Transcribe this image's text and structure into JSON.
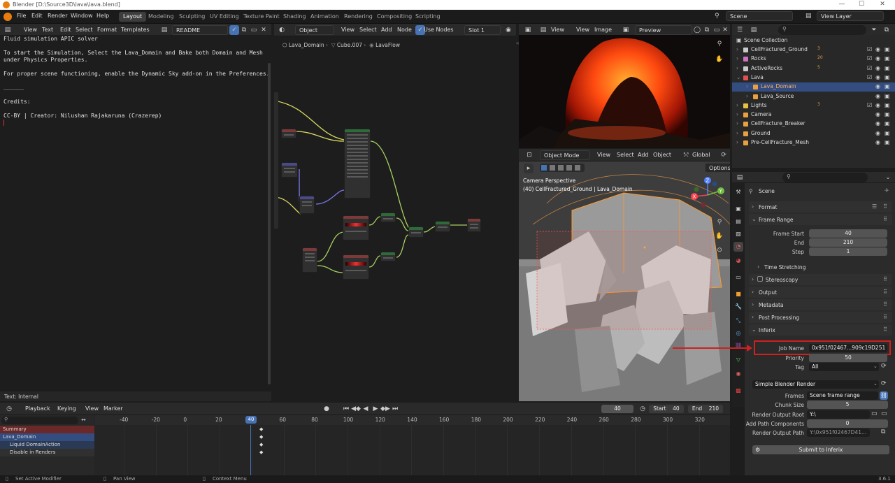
{
  "window": {
    "title": "Blender [D:\\Source3D\\lava\\lava.blend]"
  },
  "menubar": {
    "menus": [
      "File",
      "Edit",
      "Render",
      "Window",
      "Help"
    ],
    "workspaces": [
      "Layout",
      "Modeling",
      "Sculpting",
      "UV Editing",
      "Texture Paint",
      "Shading",
      "Animation",
      "Rendering",
      "Compositing",
      "Scripting"
    ],
    "active_workspace": "Layout",
    "scene": "Scene",
    "view_layer": "View Layer"
  },
  "text_editor": {
    "menus": [
      "View",
      "Text",
      "Edit",
      "Select",
      "Format",
      "Templates"
    ],
    "file": "README",
    "lines": [
      "Fluid simulation APIC solver",
      "",
      "To start the Simulation, Select the Lava_Domain and Bake both Domain and Mesh",
      "under Physics Properties.",
      "",
      "For proper scene functioning, enable the Dynamic Sky add-on in the Preferences.",
      "",
      "______",
      "",
      "Credits:",
      "",
      "CC-BY | Creator: Nilushan Rajakaruna (Crazerep)"
    ],
    "footer": "Text: Internal"
  },
  "node_editor": {
    "mode": "Object",
    "menus": [
      "View",
      "Select",
      "Add",
      "Node"
    ],
    "use_nodes": "Use Nodes",
    "slot": "Slot 1",
    "breadcrumb": [
      "Lava_Domain",
      "Cube.007",
      "LavaFlow"
    ]
  },
  "image_editor": {
    "menus": [
      "View",
      "View",
      "Image"
    ],
    "image": "Preview"
  },
  "viewport": {
    "mode": "Object Mode",
    "menus": [
      "View",
      "Select",
      "Add",
      "Object"
    ],
    "orientation": "Global",
    "options": "Options",
    "overlay_title": "Camera Perspective",
    "overlay_sub": "(40) CellFractured_Ground | Lava_Domain"
  },
  "outliner": {
    "root": "Scene Collection",
    "items": [
      {
        "label": "CellFractured_Ground",
        "badge": "3",
        "depth": 1,
        "color": "#c9c9c9"
      },
      {
        "label": "Rocks",
        "badge": "20",
        "depth": 1,
        "color": "#d070c0"
      },
      {
        "label": "ActiveRocks",
        "badge": "5",
        "depth": 1,
        "color": "#c9c9c9"
      },
      {
        "label": "Lava",
        "badge": "",
        "depth": 1,
        "color": "#e05050"
      },
      {
        "label": "Lava_Domain",
        "badge": "",
        "depth": 2,
        "color": "#e8a040"
      },
      {
        "label": "Lava_Source",
        "badge": "",
        "depth": 2,
        "color": "#e8a040"
      },
      {
        "label": "Lights",
        "badge": "3",
        "depth": 1,
        "color": "#e8c040"
      },
      {
        "label": "Camera",
        "badge": "",
        "depth": 1,
        "color": "#e8a040"
      },
      {
        "label": "CellFracture_Breaker",
        "badge": "",
        "depth": 1,
        "color": "#e8a040"
      },
      {
        "label": "Ground",
        "badge": "",
        "depth": 1,
        "color": "#e8a040"
      },
      {
        "label": "Pre-CellFracture_Mesh",
        "badge": "",
        "depth": 1,
        "color": "#e8a040"
      }
    ]
  },
  "properties": {
    "context": "Scene",
    "panels": {
      "format": "Format",
      "frame_range": "Frame Range",
      "time_stretching": "Time Stretching",
      "stereoscopy": "Stereoscopy",
      "output": "Output",
      "metadata": "Metadata",
      "post_processing": "Post Processing",
      "inferix": "Inferix"
    },
    "frame_start_label": "Frame Start",
    "frame_start": "40",
    "end_label": "End",
    "end": "210",
    "step_label": "Step",
    "step": "1",
    "job_name_label": "Job Name",
    "job_name": "0x951f02467...909c19D251",
    "priority_label": "Priority",
    "priority": "50",
    "tag_label": "Tag",
    "tag": "All",
    "render_type": "Simple Blender Render",
    "frames_label": "Frames",
    "frames": "Scene frame range",
    "chunk_size_label": "Chunk Size",
    "chunk_size": "5",
    "render_output_root_label": "Render Output Root",
    "render_output_root": "Y:\\",
    "add_path_components_label": "Add Path Components",
    "add_path_components": "0",
    "render_output_path_label": "Render Output Path",
    "render_output_path": "Y:\\0x951f02467D41...",
    "submit": "Submit to Inferix"
  },
  "timeline": {
    "menus": [
      "Playback",
      "Keying",
      "View",
      "Marker"
    ],
    "current_frame": "40",
    "start_label": "Start",
    "start": "40",
    "end_label": "End",
    "end": "210",
    "ruler": [
      "-40",
      "-20",
      "0",
      "20",
      "40",
      "60",
      "80",
      "100",
      "120",
      "140",
      "160",
      "180",
      "200",
      "220",
      "240",
      "260",
      "280",
      "300",
      "320"
    ],
    "channels": [
      "Summary",
      "Lava_Domain",
      "Liquid DomainAction",
      "Disable in Renders"
    ]
  },
  "statusbar": {
    "left": "Set Active Modifier",
    "mid": "Pan View",
    "right": "Context Menu",
    "version": "3.6.1"
  },
  "colors": {
    "accent": "#4772b3",
    "highlight_box": "#d02020"
  }
}
